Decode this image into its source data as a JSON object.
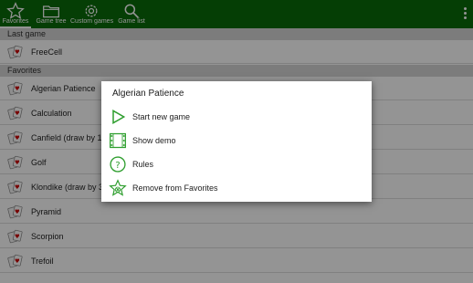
{
  "toolbar": {
    "tabs": [
      {
        "label": "Favorites",
        "icon": "star-icon",
        "active": true
      },
      {
        "label": "Game tree",
        "icon": "folder-icon",
        "active": false
      },
      {
        "label": "Custom games",
        "icon": "gear-icon",
        "active": false
      },
      {
        "label": "Game list",
        "icon": "search-icon",
        "active": false
      }
    ],
    "overflow_icon": "overflow-menu-icon"
  },
  "sections": {
    "last_game": "Last game",
    "favorites": "Favorites"
  },
  "last_game_items": [
    {
      "label": "FreeCell"
    }
  ],
  "favorite_items": [
    {
      "label": "Algerian Patience"
    },
    {
      "label": "Calculation"
    },
    {
      "label": "Canfield (draw by 1)"
    },
    {
      "label": "Golf"
    },
    {
      "label": "Klondike (draw by 3)"
    },
    {
      "label": "Pyramid"
    },
    {
      "label": "Scorpion"
    },
    {
      "label": "Trefoil"
    }
  ],
  "dialog": {
    "title": "Algerian Patience",
    "items": [
      {
        "label": "Start new game",
        "icon": "play-icon"
      },
      {
        "label": "Show demo",
        "icon": "film-icon"
      },
      {
        "label": "Rules",
        "icon": "help-icon"
      },
      {
        "label": "Remove from Favorites",
        "icon": "remove-star-icon"
      }
    ]
  },
  "colors": {
    "toolbar": "#0a6b0a",
    "accent_green": "#2e9e2e",
    "section_header": "#d6d6d6"
  }
}
